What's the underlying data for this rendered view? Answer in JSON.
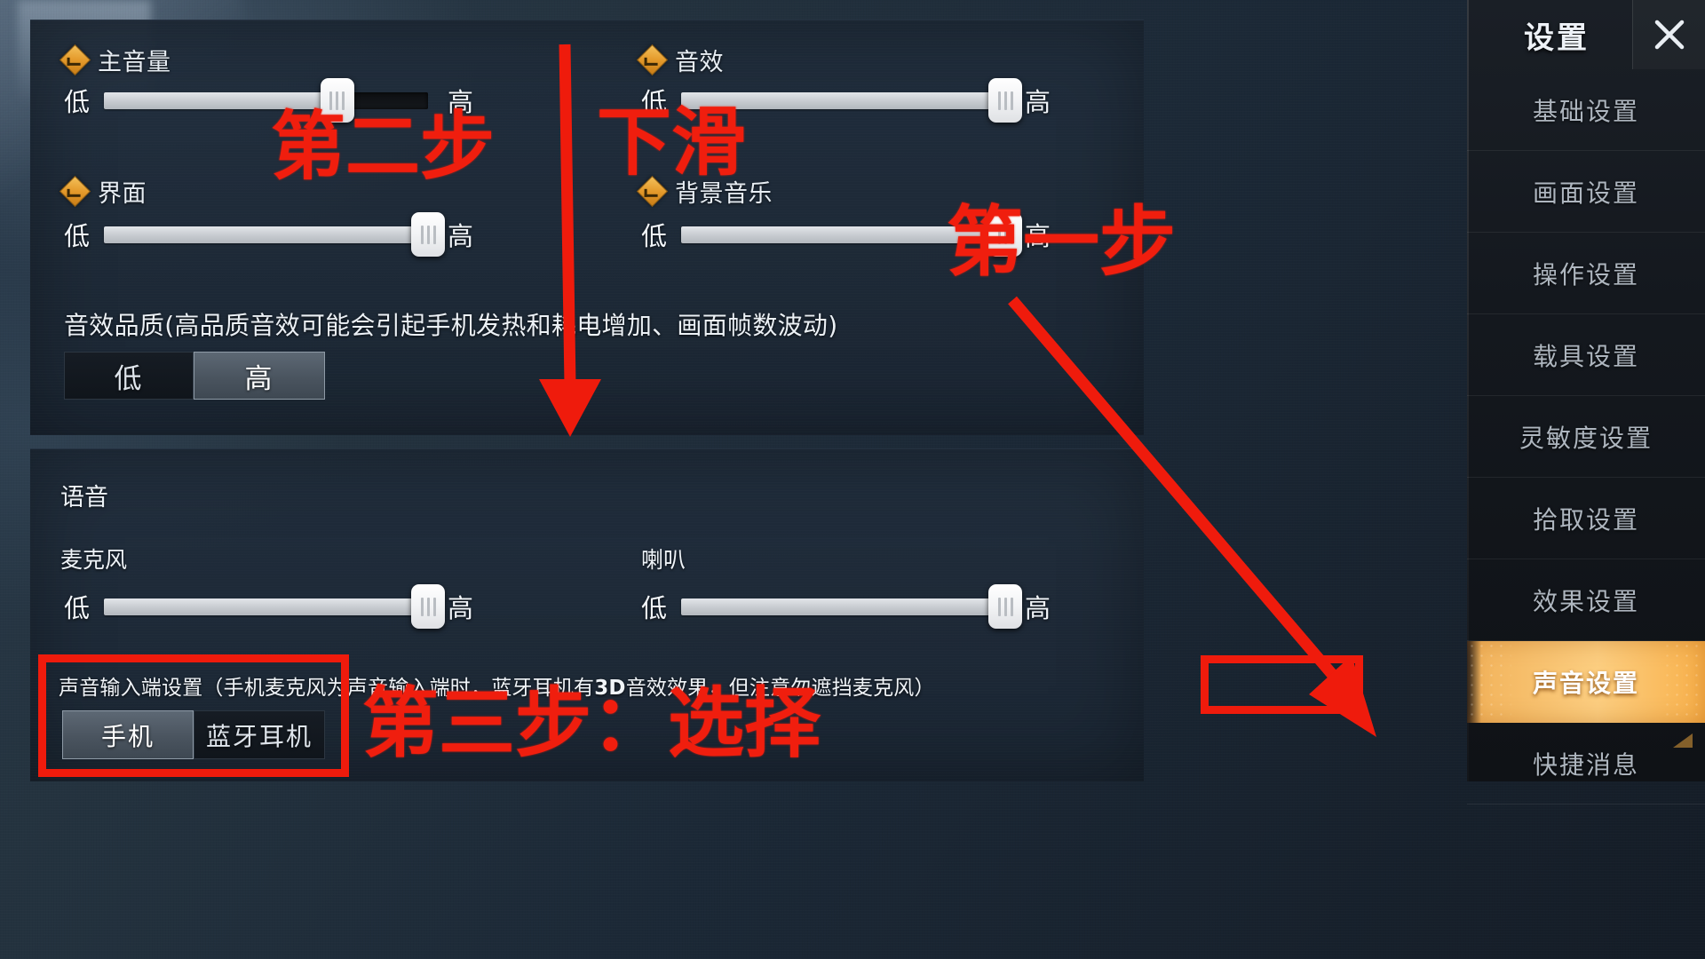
{
  "settings_panel": {
    "audio_section": {
      "options": [
        {
          "id": "master-volume",
          "label": "主音量",
          "low": "低",
          "high": "高",
          "value": 72,
          "has_checkbox": true
        },
        {
          "id": "sound-effects",
          "label": "音效",
          "low": "低",
          "high": "高",
          "value": 100,
          "has_checkbox": true
        },
        {
          "id": "interface",
          "label": "界面",
          "low": "低",
          "high": "高",
          "value": 100,
          "has_checkbox": true
        },
        {
          "id": "background-music",
          "label": "背景音乐",
          "low": "低",
          "high": "高",
          "value": 100,
          "has_checkbox": true
        }
      ],
      "quality_label": "音效品质(高品质音效可能会引起手机发热和耗电增加、画面帧数波动)",
      "quality_options": [
        "低",
        "高"
      ],
      "quality_selected": "高"
    },
    "voice_section": {
      "title": "语音",
      "sliders": [
        {
          "id": "microphone",
          "label": "麦克风",
          "low": "低",
          "high": "高",
          "value": 100
        },
        {
          "id": "speaker",
          "label": "喇叭",
          "low": "低",
          "high": "高",
          "value": 100
        }
      ],
      "input_source_desc_part1": "声音输入端设置（手机麦克风为声音输入端时，蓝牙耳机有",
      "input_source_desc_bold": "3D",
      "input_source_desc_part2": "音效效果，但注意勿遮挡麦克风）",
      "input_source_options": [
        "手机",
        "蓝牙耳机"
      ],
      "input_source_selected": "手机"
    }
  },
  "sidebar": {
    "title": "设置",
    "close_icon": "close-icon",
    "items": [
      {
        "label": "基础设置",
        "active": false
      },
      {
        "label": "画面设置",
        "active": false
      },
      {
        "label": "操作设置",
        "active": false
      },
      {
        "label": "载具设置",
        "active": false
      },
      {
        "label": "灵敏度设置",
        "active": false
      },
      {
        "label": "拾取设置",
        "active": false
      },
      {
        "label": "效果设置",
        "active": false
      },
      {
        "label": "声音设置",
        "active": true
      },
      {
        "label": "快捷消息",
        "active": false
      }
    ]
  },
  "annotations": {
    "accent_color": "#ef1b0c",
    "step1": "第一步",
    "step2": "第二步",
    "step2_extra": "下滑",
    "step3": "第三步：选择"
  }
}
